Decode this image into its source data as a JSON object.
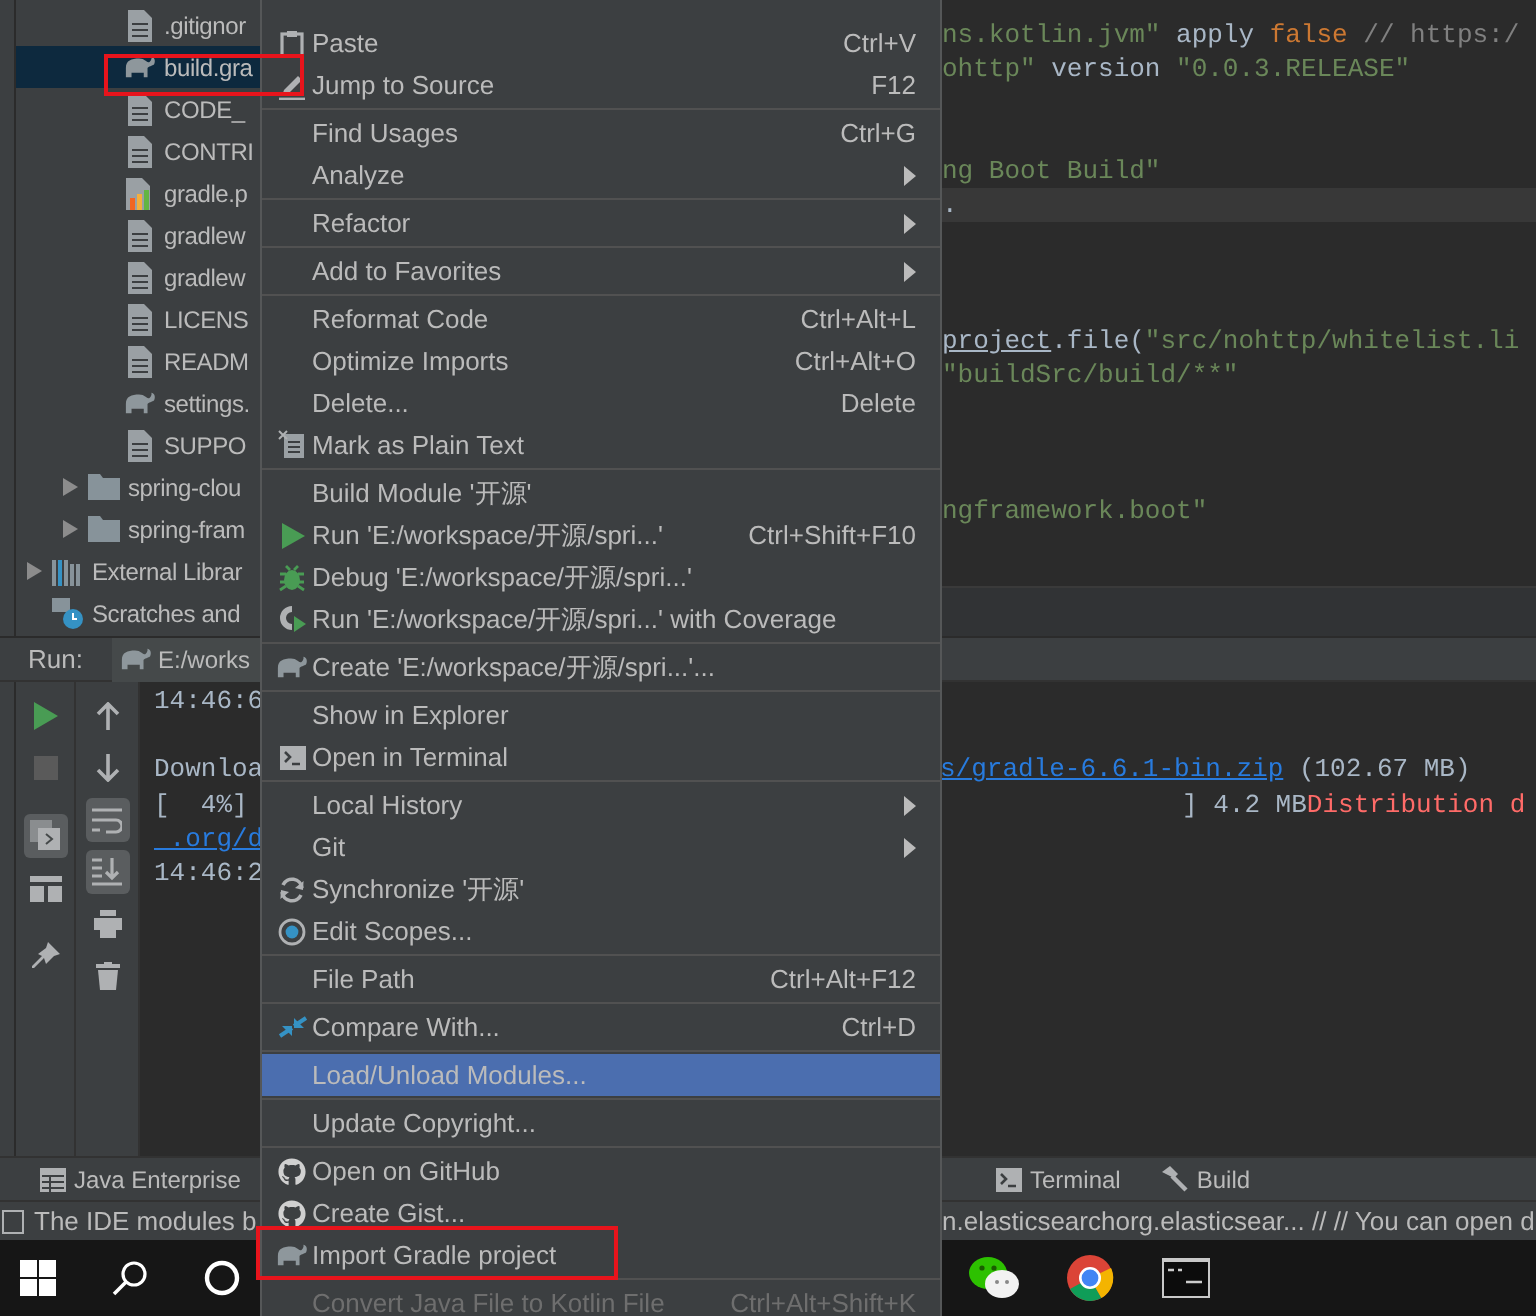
{
  "project_tree": {
    "items": [
      {
        "children": [
          {
            "children": [
              {
                "label": ".gitignor",
                "kind": "file",
                "selected": false
              },
              {
                "label": "build.gra",
                "kind": "gradle",
                "selected": true,
                "boxed": true
              },
              {
                "label": "CODE_",
                "kind": "file",
                "selected": false
              },
              {
                "label": "CONTRI",
                "kind": "file",
                "selected": false
              },
              {
                "label": "gradle.p",
                "kind": "properties",
                "selected": false
              },
              {
                "label": "gradlew",
                "kind": "file",
                "selected": false
              },
              {
                "label": "gradlew",
                "kind": "file",
                "selected": false
              },
              {
                "label": "LICENS",
                "kind": "file",
                "selected": false
              },
              {
                "label": "READM",
                "kind": "file",
                "selected": false
              },
              {
                "label": "settings.",
                "kind": "gradle",
                "selected": false
              },
              {
                "label": "SUPPO",
                "kind": "file",
                "selected": false
              }
            ]
          },
          {
            "label": "spring-clou",
            "kind": "folder",
            "selected": false,
            "expanded": false
          },
          {
            "label": "spring-fram",
            "kind": "folder",
            "selected": false,
            "expanded": false
          }
        ]
      },
      {
        "label": "External Librar",
        "kind": "library",
        "selected": false,
        "expanded": false
      },
      {
        "label": "Scratches and",
        "kind": "scratch",
        "selected": false
      }
    ]
  },
  "editor": {
    "lines": [
      {
        "current": false,
        "tokens": [
          {
            "text": "ns.kotlin.jvm\"",
            "kind": "string"
          },
          {
            "text": " apply ",
            "kind": "plain"
          },
          {
            "text": "false",
            "kind": "keyword"
          },
          {
            "text": " // https:/",
            "kind": "comment"
          }
        ]
      },
      {
        "current": false,
        "tokens": [
          {
            "text": "ohttp\"",
            "kind": "string"
          },
          {
            "text": " version ",
            "kind": "plain"
          },
          {
            "text": "\"0.0.3.RELEASE\"",
            "kind": "string"
          }
        ]
      },
      {
        "current": false,
        "tokens": [
          {
            "text": "ng Boot Build\"",
            "kind": "string"
          }
        ]
      },
      {
        "current": true,
        "tokens": [
          {
            "text": ".",
            "kind": "plain"
          }
        ]
      },
      {
        "current": false,
        "tokens": [
          {
            "text": "project",
            "kind": "underlined"
          },
          {
            "text": ".file(",
            "kind": "plain"
          },
          {
            "text": "\"src/nohttp/whitelist.li",
            "kind": "string"
          }
        ]
      },
      {
        "current": false,
        "tokens": [
          {
            "text": "\"buildSrc/build/**\"",
            "kind": "string"
          }
        ]
      },
      {
        "current": false,
        "tokens": [
          {
            "text": "ngframework.boot\"",
            "kind": "string"
          }
        ]
      }
    ]
  },
  "run_panel": {
    "title": "Run:",
    "tab": {
      "label": "E:/works",
      "kind": "gradle"
    },
    "toolbar_left": [
      {
        "kind": "run",
        "on": false
      },
      {
        "kind": "stop",
        "on": false
      },
      {
        "kind": "restore",
        "on": true
      },
      {
        "kind": "layout",
        "on": false
      },
      {
        "kind": "pin",
        "on": false
      }
    ],
    "toolbar_right": [
      {
        "kind": "up",
        "on": false
      },
      {
        "kind": "down",
        "on": false
      },
      {
        "kind": "wrap",
        "on": true
      },
      {
        "kind": "scroll-end",
        "on": true
      },
      {
        "kind": "print",
        "on": false
      },
      {
        "kind": "trash",
        "on": false
      }
    ],
    "console": [
      {
        "left": [
          {
            "text": "14:46:6",
            "kind": "plain"
          }
        ]
      },
      {
        "left": [
          {
            "text": "Downloa",
            "kind": "plain"
          }
        ],
        "right": [
          {
            "text": "s/gradle-6.6.1-bin.zip",
            "kind": "link"
          },
          {
            "text": " (102.67 MB)",
            "kind": "plain"
          }
        ]
      },
      {
        "left": [
          {
            "text": "[  4%]",
            "kind": "plain"
          }
        ],
        "right": [
          {
            "text": "] 4.2 MB",
            "kind": "plain"
          },
          {
            "text": "Distribution d",
            "kind": "error"
          }
        ]
      },
      {
        "left": [
          {
            "text": " .org/d",
            "kind": "link"
          }
        ]
      },
      {
        "left": [
          {
            "text": "14:46:2",
            "kind": "plain"
          }
        ]
      }
    ]
  },
  "context_menu": [
    {
      "kind": "paste",
      "label": "Paste",
      "shortcut": "Ctrl+V",
      "selected": false
    },
    {
      "kind": "pencil",
      "label": "Jump to Source",
      "shortcut": "F12",
      "selected": false
    },
    {
      "kind": "separator"
    },
    {
      "kind": "text",
      "label": "Find Usages",
      "shortcut": "Ctrl+G",
      "selected": false
    },
    {
      "kind": "text",
      "label": "Analyze",
      "submenu": true,
      "selected": false
    },
    {
      "kind": "separator"
    },
    {
      "kind": "text",
      "label": "Refactor",
      "submenu": true,
      "selected": false
    },
    {
      "kind": "separator"
    },
    {
      "kind": "text",
      "label": "Add to Favorites",
      "submenu": true,
      "selected": false
    },
    {
      "kind": "separator"
    },
    {
      "kind": "text",
      "label": "Reformat Code",
      "shortcut": "Ctrl+Alt+L",
      "selected": false
    },
    {
      "kind": "text",
      "label": "Optimize Imports",
      "shortcut": "Ctrl+Alt+O",
      "selected": false
    },
    {
      "kind": "text",
      "label": "Delete...",
      "shortcut": "Delete",
      "selected": false
    },
    {
      "kind": "plain-text",
      "label": "Mark as Plain Text",
      "selected": false
    },
    {
      "kind": "separator"
    },
    {
      "kind": "text",
      "label": "Build Module '开源'",
      "selected": false
    },
    {
      "kind": "run",
      "label": "Run 'E:/workspace/开源/spri...'",
      "shortcut": "Ctrl+Shift+F10",
      "selected": false
    },
    {
      "kind": "bug",
      "label": "Debug 'E:/workspace/开源/spri...'",
      "selected": false
    },
    {
      "kind": "coverage",
      "label": "Run 'E:/workspace/开源/spri...' with Coverage",
      "selected": false
    },
    {
      "kind": "separator"
    },
    {
      "kind": "gradle",
      "label": "Create 'E:/workspace/开源/spri...'...",
      "selected": false
    },
    {
      "kind": "separator"
    },
    {
      "kind": "text",
      "label": "Show in Explorer",
      "selected": false
    },
    {
      "kind": "terminal",
      "label": "Open in Terminal",
      "selected": false
    },
    {
      "kind": "separator"
    },
    {
      "kind": "text",
      "label": "Local History",
      "submenu": true,
      "selected": false
    },
    {
      "kind": "text",
      "label": "Git",
      "submenu": true,
      "selected": false
    },
    {
      "kind": "sync",
      "label": "Synchronize '开源'",
      "selected": false
    },
    {
      "kind": "scope",
      "label": "Edit Scopes...",
      "selected": false
    },
    {
      "kind": "separator"
    },
    {
      "kind": "text",
      "label": "File Path",
      "shortcut": "Ctrl+Alt+F12",
      "selected": false
    },
    {
      "kind": "separator"
    },
    {
      "kind": "compare",
      "label": "Compare With...",
      "shortcut": "Ctrl+D",
      "selected": false
    },
    {
      "kind": "separator"
    },
    {
      "kind": "text",
      "label": "Load/Unload Modules...",
      "selected": true
    },
    {
      "kind": "separator"
    },
    {
      "kind": "text",
      "label": "Update Copyright...",
      "selected": false
    },
    {
      "kind": "separator"
    },
    {
      "kind": "github",
      "label": "Open on GitHub",
      "selected": false
    },
    {
      "kind": "github",
      "label": "Create Gist...",
      "selected": false
    },
    {
      "kind": "gradle",
      "label": "Import Gradle project",
      "selected": false,
      "boxed": true
    },
    {
      "kind": "separator"
    },
    {
      "kind": "text",
      "label": "Convert Java File to Kotlin File",
      "shortcut": "Ctrl+Alt+Shift+K",
      "selected": false,
      "disabled": true
    }
  ],
  "tool_tabs": {
    "left": [
      {
        "label": "Java Enterprise",
        "kind": "table"
      }
    ],
    "right": [
      {
        "label": "Terminal",
        "kind": "terminal"
      },
      {
        "label": "Build",
        "kind": "hammer"
      }
    ]
  },
  "status_bar": {
    "left": "The IDE modules b",
    "right": "n.elasticsearchorg.elasticsear... // // You can open d"
  },
  "taskbar": {
    "start": [
      {
        "kind": "windows"
      },
      {
        "kind": "search"
      },
      {
        "kind": "cortana"
      }
    ],
    "apps": [
      {
        "kind": "wechat"
      },
      {
        "kind": "chrome"
      },
      {
        "kind": "console"
      }
    ]
  }
}
